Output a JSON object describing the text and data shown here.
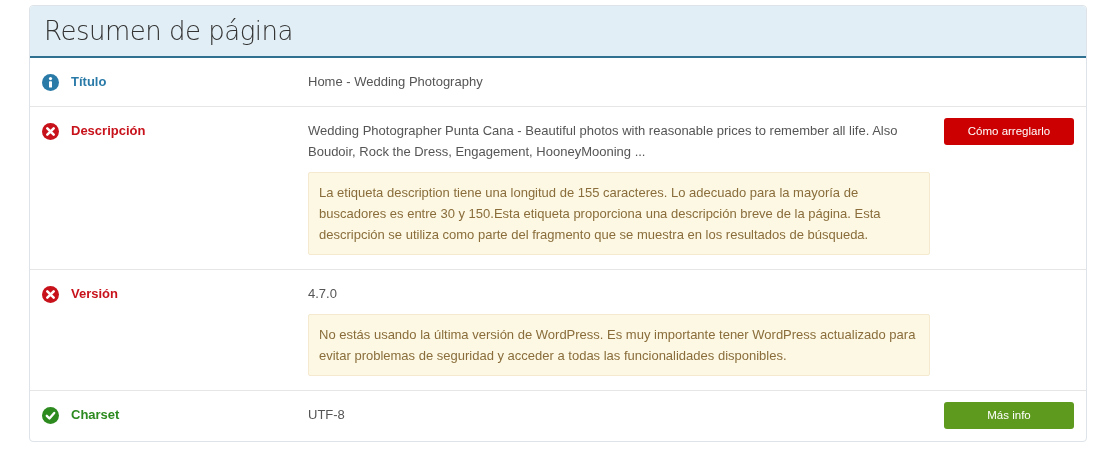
{
  "panel": {
    "title": "Resumen de página"
  },
  "rows": [
    {
      "kind": "info",
      "label": "Título",
      "value": "Home - Wedding Photography"
    },
    {
      "kind": "error",
      "label": "Descripción",
      "value": "Wedding Photographer Punta Cana - Beautiful photos with reasonable prices to remember all life. Also Boudoir, Rock the Dress, Engagement, HooneyMooning ...",
      "notice": "La etiqueta description tiene una longitud de 155 caracteres. Lo adecuado para la mayoría de buscadores es entre 30 y 150.Esta etiqueta proporciona una descripción breve de la página. Esta descripción se utiliza como parte del fragmento que se muestra en los resultados de búsqueda.",
      "button": "Cómo arreglarlo"
    },
    {
      "kind": "error",
      "label": "Versión",
      "value": "4.7.0",
      "notice": "No estás usando la última versión de WordPress. Es muy importante tener WordPress actualizado para evitar problemas de seguridad y acceder a todas las funcionalidades disponibles."
    },
    {
      "kind": "ok",
      "label": "Charset",
      "value": "UTF-8",
      "button": "Más info"
    }
  ]
}
